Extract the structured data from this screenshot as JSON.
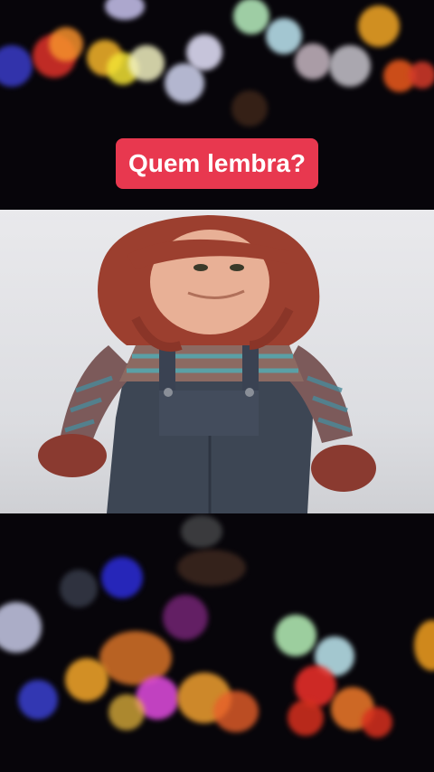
{
  "caption": {
    "text": "Quem lembra?",
    "background": "#e8384f",
    "color": "#ffffff"
  },
  "photo": {
    "subject": "doll-with-red-yarn-hair-striped-sweater-denim-overalls"
  },
  "background": {
    "style": "bokeh-lights"
  }
}
